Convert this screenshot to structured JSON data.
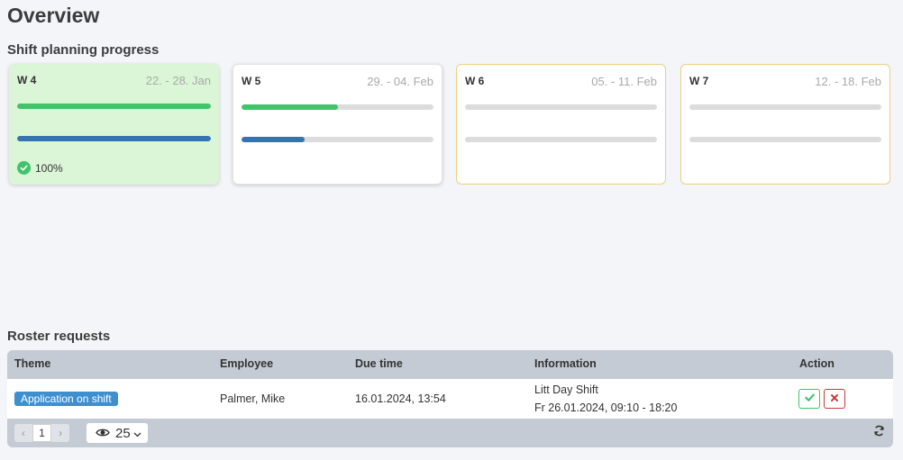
{
  "page": {
    "title": "Overview"
  },
  "progress": {
    "title": "Shift planning progress",
    "cards": [
      {
        "week": "W 4",
        "range": "22. - 28. Jan",
        "state": "done",
        "green": 1.0,
        "blue": 1.0,
        "status": "100%"
      },
      {
        "week": "W 5",
        "range": "29. - 04. Feb",
        "state": "normal",
        "green": 0.5,
        "blue": 0.33
      },
      {
        "week": "W 6",
        "range": "05. - 11. Feb",
        "state": "pending",
        "green": 0,
        "blue": 0
      },
      {
        "week": "W 7",
        "range": "12. - 18. Feb",
        "state": "pending",
        "green": 0,
        "blue": 0
      }
    ]
  },
  "requests": {
    "title": "Roster requests",
    "columns": {
      "theme": "Theme",
      "employee": "Employee",
      "due": "Due time",
      "info": "Information",
      "action": "Action"
    },
    "rows": [
      {
        "theme": "Application on shift",
        "employee": "Palmer, Mike",
        "due": "16.01.2024, 13:54",
        "info_line1": "Litt Day Shift",
        "info_line2": "Fr 26.01.2024, 09:10 - 18:20"
      }
    ],
    "footer": {
      "prev": "‹",
      "page": "1",
      "next": "›",
      "per_page": "25"
    }
  },
  "colors": {
    "accent_green": "#3fc46a",
    "accent_blue": "#3574b1",
    "badge_blue": "#3d8fd0",
    "reject_red": "#c83a3a",
    "pending_border": "#f0cd7f"
  },
  "icons": {
    "status": "check-circle-icon",
    "accept": "check-icon",
    "reject": "close-icon",
    "per_page": "eye-icon",
    "refresh": "refresh-icon"
  }
}
